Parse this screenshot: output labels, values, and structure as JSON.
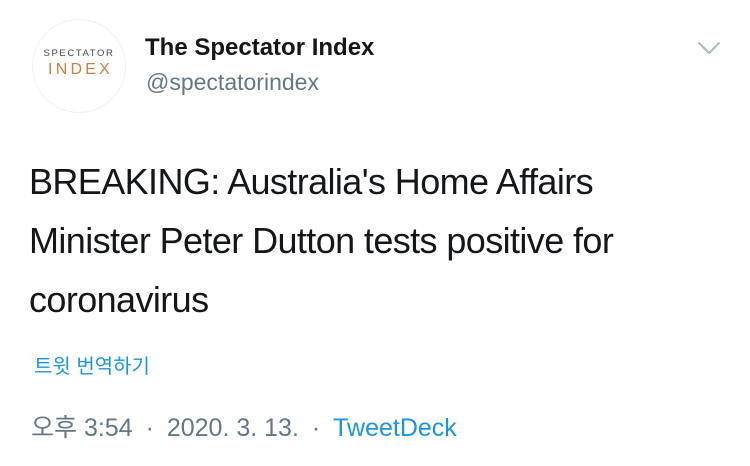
{
  "author": {
    "avatar_logo": {
      "top_text": "SPECTATOR",
      "bottom_text": "INDEX",
      "accent_color": "#c9803f"
    },
    "display_name": "The Spectator Index",
    "handle": "@spectatorindex"
  },
  "menu": {
    "icon": "chevron-down-icon"
  },
  "tweet": {
    "text": "BREAKING: Australia's Home Affairs\nMinister Peter Dutton tests positive for\ncoronavirus",
    "translate_label": "트윗 번역하기"
  },
  "meta": {
    "time": "오후 3:54",
    "separator": "·",
    "date": "2020. 3. 13.",
    "source": "TweetDeck"
  },
  "colors": {
    "link": "#1b95e0",
    "secondary_text": "#657786",
    "primary_text": "#14171a"
  }
}
